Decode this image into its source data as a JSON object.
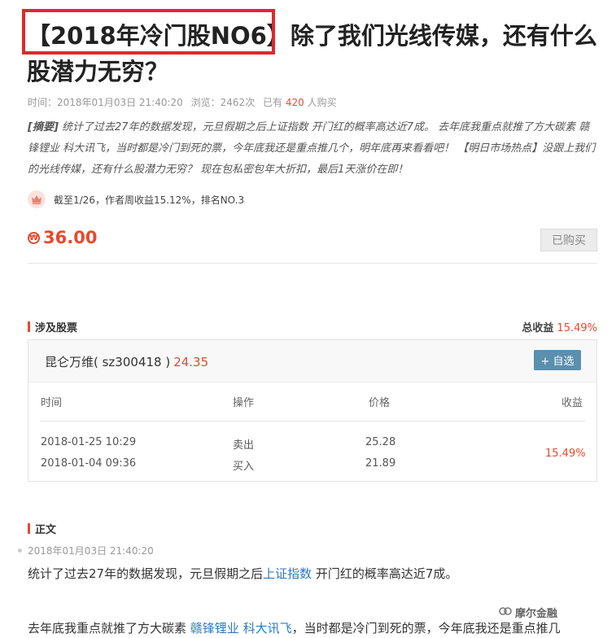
{
  "article": {
    "title_tag": "【2018年冷门股NO6】",
    "title_rest": "除了我们光线传媒，还有什么股潜力无穷？",
    "meta": {
      "time_label": "时间：",
      "time": "2018年01月03日 21:40:20",
      "views_label": "浏览：",
      "views": "2462次",
      "buyers_prefix": "已有",
      "buyers_count": "420",
      "buyers_suffix": "人购买"
    },
    "abstract": {
      "tag": "[摘要]",
      "text": "统计了过去27年的数据发现，元旦假期之后上证指数 开门红的概率高达近7成。 去年底我重点就推了方大碳素 赣锋锂业 科大讯飞，当时都是冷门到死的票，今年底我还是重点推几个，明年底再来看看吧！ 【明日市场热点】没跟上我们的光线传媒，还有什么股潜力无穷？ 现在包私密包年大折扣，最后1天涨价在即！"
    },
    "rank_text": "截至1/26，作者周收益15.12%，排名NO.3",
    "price_symbol": "₩",
    "price": "36.00",
    "buy_button": "已购买"
  },
  "stocks_section": {
    "title": "涉及股票",
    "total_label": "总收益",
    "total_value": "15.49%",
    "stock": {
      "name": "昆仑万维( sz300418 )",
      "price": "24.35",
      "add_button": "+ 自选"
    },
    "columns": [
      "时间",
      "操作",
      "价格",
      "收益"
    ],
    "rows": [
      {
        "time": "2018-01-25 10:29",
        "action": "卖出",
        "price": "25.28"
      },
      {
        "time": "2018-01-04 09:36",
        "action": "买入",
        "price": "21.89"
      }
    ],
    "profit": "15.49%"
  },
  "body_section": {
    "title": "正文",
    "date": "2018年01月03日 21:40:20",
    "p1_before": "统计了过去27年的数据发现，元旦假期之后",
    "p1_link": "上证指数",
    "p1_after": " 开门红的概率高达近7成。",
    "p2_before": "去年底我重点就推了方大碳素 ",
    "p2_link1": "赣锋锂业",
    "p2_link2": "科大讯飞",
    "p2_after": "，当时都是冷门到死的票，今年底我还是重点推几"
  },
  "watermark": "摩尔金融",
  "colors": {
    "accent": "#e8492d",
    "highlight_box": "#e0282c",
    "link": "#2e7bbf",
    "button": "#5a8fae"
  }
}
